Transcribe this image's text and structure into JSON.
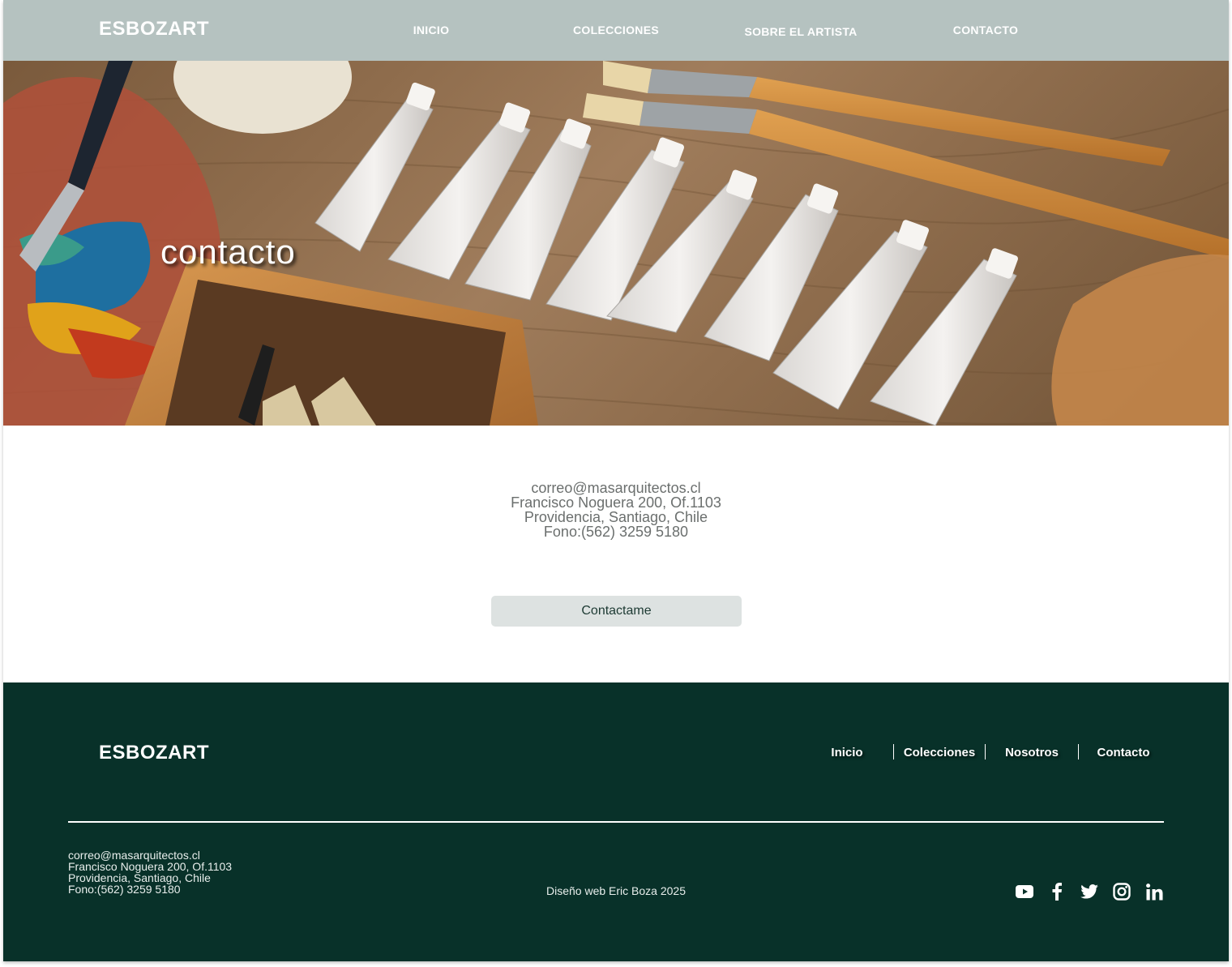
{
  "header": {
    "brand": "ESBOZART",
    "nav": [
      "INICIO",
      "COLECCIONES",
      "SOBRE EL ARTISTA",
      "CONTACTO"
    ]
  },
  "hero": {
    "title": "contacto"
  },
  "contact": {
    "lines": [
      "correo@masarquitectos.cl",
      "Francisco Noguera 200, Of.1103",
      "Providencia, Santiago, Chile",
      "Fono:(562) 3259 5180"
    ],
    "button_label": "Contactame"
  },
  "footer": {
    "brand": "ESBOZART",
    "nav": [
      "Inicio",
      "Colecciones",
      "Nosotros",
      "Contacto"
    ],
    "contact_lines": [
      "correo@masarquitectos.cl",
      "Francisco Noguera 200, Of.1103",
      "Providencia, Santiago, Chile",
      "Fono:(562) 3259 5180"
    ],
    "credit": "Diseño web Eric Boza 2025",
    "social_icons": [
      "youtube-icon",
      "facebook-icon",
      "twitter-icon",
      "instagram-icon",
      "linkedin-icon"
    ]
  },
  "colors": {
    "header_bg": "#b5c2c0",
    "footer_bg": "#083129",
    "button_bg": "#dde2e1"
  }
}
